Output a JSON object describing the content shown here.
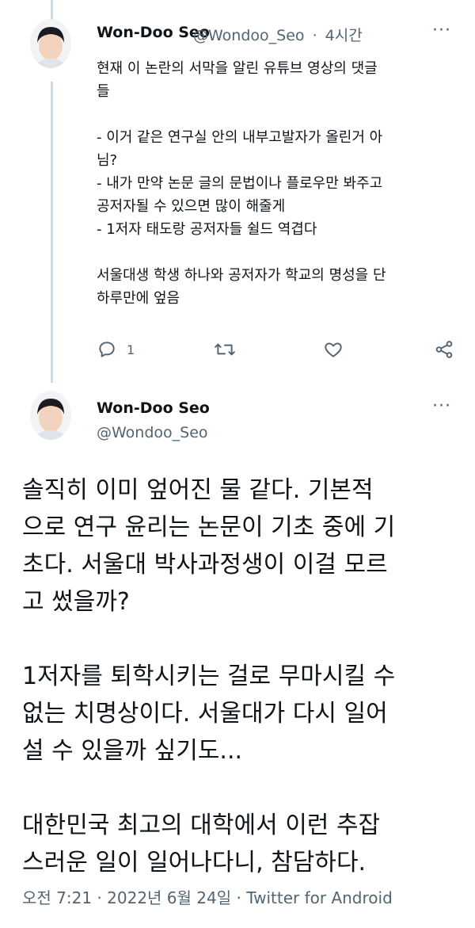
{
  "tweet1": {
    "name": "Won-Doo Seo",
    "handle": "@Wondoo_Seo",
    "time_sep": "·",
    "time": "4시간",
    "text": "현재 이 논란의 서막을 알린 유튜브 영상의 댓글\n들\n\n- 이거 같은 연구실 안의 내부고발자가 올린거 아\n님?\n- 내가 만약 논문 글의 문법이나 플로우만 봐주고\n공저자될 수 있으면 많이 해줄게\n- 1저자 태도랑 공저자들 쉴드 역겹다\n\n서울대생 학생 하나와 공저자가 학교의 명성을 단\n하루만에 엎음",
    "reply_count": "1",
    "icons": [
      "reply-icon",
      "retweet-icon",
      "like-icon",
      "share-icon",
      "more-icon"
    ]
  },
  "tweet2": {
    "name": "Won-Doo Seo",
    "handle": "@Wondoo_Seo",
    "text": "솔직히 이미 엎어진 물 같다. 기본적\n으로 연구 윤리는 논문이 기초 중에 기\n초다. 서울대 박사과정생이 이걸 모르\n고 썼을까?\n\n1저자를 퇴학시키는 걸로 무마시킬 수\n없는 치명상이다. 서울대가 다시 일어\n설 수 있을까 싶기도...\n\n대한민국 최고의 대학에서 이런 추잡\n스러운 일이 일어나다니, 참담하다.",
    "footer": "오전 7:21 · 2022년 6월 24일 · Twitter for Android"
  },
  "colors": {
    "text": "#0f1419",
    "secondary": "#536471",
    "thread": "#cfd9de"
  }
}
